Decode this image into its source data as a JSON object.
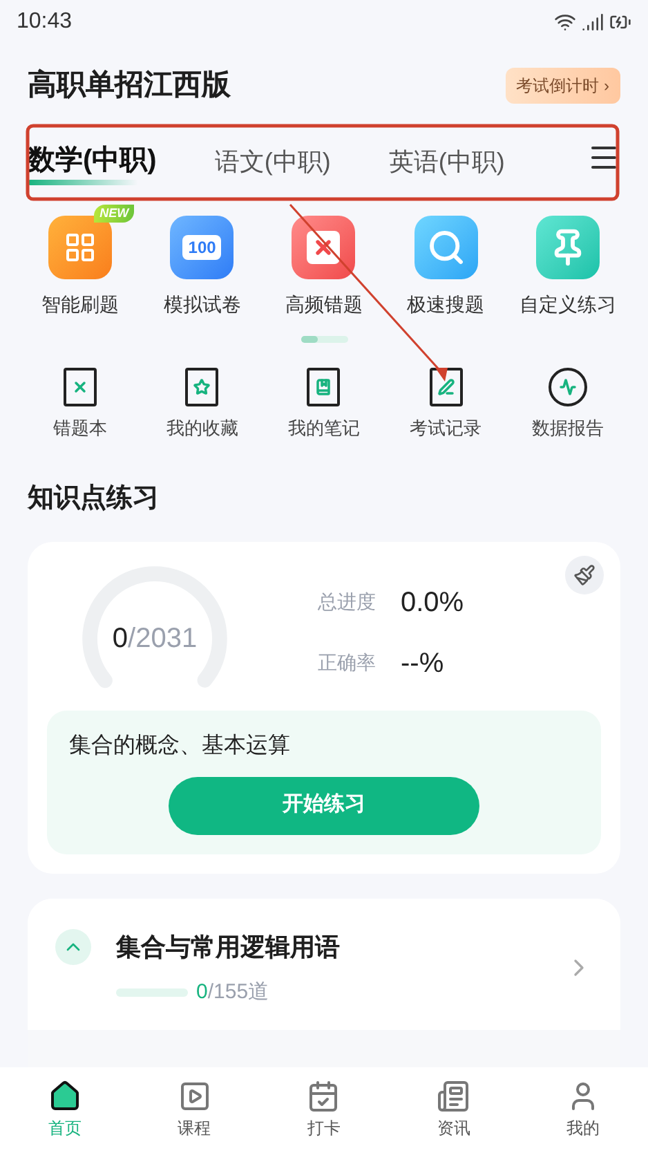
{
  "status_bar": {
    "time": "10:43"
  },
  "header": {
    "title": "高职单招江西版",
    "countdown_button": "考试倒计时 ›"
  },
  "tabs": [
    {
      "label": "数学(中职)",
      "selected": true
    },
    {
      "label": "语文(中职)",
      "selected": false
    },
    {
      "label": "英语(中职)",
      "selected": false
    }
  ],
  "features": [
    {
      "kind": "smart",
      "label": "智能刷题",
      "badge": "NEW"
    },
    {
      "kind": "paper",
      "label": "模拟试卷",
      "icon_text": "100"
    },
    {
      "kind": "wrong",
      "label": "高频错题"
    },
    {
      "kind": "search",
      "label": "极速搜题"
    },
    {
      "kind": "pin",
      "label": "自定义练习"
    }
  ],
  "tools": [
    {
      "kind": "wrongbook",
      "label": "错题本"
    },
    {
      "kind": "favorites",
      "label": "我的收藏"
    },
    {
      "kind": "notes",
      "label": "我的笔记"
    },
    {
      "kind": "records",
      "label": "考试记录"
    },
    {
      "kind": "report",
      "label": "数据报告"
    }
  ],
  "section_title": "知识点练习",
  "progress_card": {
    "done": "0",
    "total": "/2031",
    "stats": [
      {
        "label": "总进度",
        "value": "0.0%"
      },
      {
        "label": "正确率",
        "value": "--%"
      }
    ],
    "current_topic": "集合的概念、基本运算",
    "start_button": "开始练习"
  },
  "chapters": [
    {
      "title": "集合与常用逻辑用语",
      "expanded": true,
      "done": "0",
      "total": "/155道"
    }
  ],
  "bottom_nav": [
    {
      "kind": "home",
      "label": "首页",
      "selected": true
    },
    {
      "kind": "course",
      "label": "课程",
      "selected": false
    },
    {
      "kind": "checkin",
      "label": "打卡",
      "selected": false
    },
    {
      "kind": "news",
      "label": "资讯",
      "selected": false
    },
    {
      "kind": "me",
      "label": "我的",
      "selected": false
    }
  ]
}
